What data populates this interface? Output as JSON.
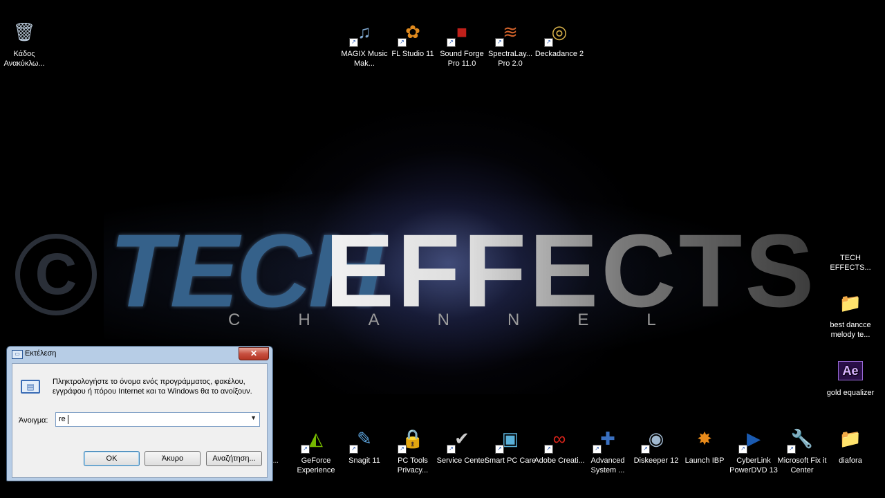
{
  "wallpaper": {
    "logo_tech": "TECH",
    "logo_effects": "EFFECTS",
    "logo_channel": "CHANNEL",
    "logo_symbol": "C"
  },
  "desktop_icons": [
    {
      "id": "recycle-bin",
      "label": "Κάδος Ανακύκλω...",
      "icon": "recycle-bin-icon",
      "color": "#b8c8d8",
      "glyph": "🗑",
      "shortcut": false
    },
    {
      "id": "magix",
      "label": "MAGIX Music Mak...",
      "icon": "magix-icon",
      "color": "#7fa8d0",
      "glyph": "♫",
      "shortcut": true
    },
    {
      "id": "fl-studio",
      "label": "FL Studio 11",
      "icon": "fl-studio-icon",
      "color": "#e08a1e",
      "glyph": "✿",
      "shortcut": true
    },
    {
      "id": "sound-forge",
      "label": "Sound Forge Pro 11.0",
      "icon": "sound-forge-icon",
      "color": "#c0201a",
      "glyph": "■",
      "shortcut": true
    },
    {
      "id": "spectralayers",
      "label": "SpectraLay... Pro 2.0",
      "icon": "spectralayers-icon",
      "color": "#d2622a",
      "glyph": "≋",
      "shortcut": true
    },
    {
      "id": "deckadance",
      "label": "Deckadance 2",
      "icon": "deckadance-icon",
      "color": "#d9b24a",
      "glyph": "◎",
      "shortcut": true
    },
    {
      "id": "tech-effects",
      "label": "TECH EFFECTS...",
      "icon": "tech-effects-icon",
      "color": "#000000",
      "glyph": "",
      "shortcut": false
    },
    {
      "id": "best-dance",
      "label": "best dancce melody te...",
      "icon": "folder-icon",
      "color": "#e8c66a",
      "glyph": "📁",
      "shortcut": false
    },
    {
      "id": "gold-equalizer",
      "label": "gold equalizer",
      "icon": "after-effects-file-icon",
      "color": "#3a1b5c",
      "glyph": "Ae",
      "shortcut": false
    },
    {
      "id": "partial",
      "label": "...ell...",
      "icon": "partial-app-icon",
      "color": "#4a7ab0",
      "glyph": "◐",
      "shortcut": true
    },
    {
      "id": "geforce",
      "label": "GeForce Experience",
      "icon": "geforce-icon",
      "color": "#76b900",
      "glyph": "◭",
      "shortcut": true
    },
    {
      "id": "snagit",
      "label": "Snagit 11",
      "icon": "snagit-icon",
      "color": "#5aa0d8",
      "glyph": "✎",
      "shortcut": true
    },
    {
      "id": "pc-tools",
      "label": "PC Tools Privacy...",
      "icon": "pc-tools-icon",
      "color": "#3a8ad8",
      "glyph": "🔒",
      "shortcut": true
    },
    {
      "id": "service-center",
      "label": "Service Center",
      "icon": "service-center-icon",
      "color": "#cccccc",
      "glyph": "✔",
      "shortcut": true
    },
    {
      "id": "smart-pc-care",
      "label": "Smart PC Care",
      "icon": "smart-pc-care-icon",
      "color": "#5ab0d8",
      "glyph": "▣",
      "shortcut": true
    },
    {
      "id": "adobe-creative",
      "label": "Adobe Creati...",
      "icon": "adobe-creative-cloud-icon",
      "color": "#d8231a",
      "glyph": "∞",
      "shortcut": true
    },
    {
      "id": "advanced-system",
      "label": "Advanced System ...",
      "icon": "advanced-system-care-icon",
      "color": "#3a70c0",
      "glyph": "✚",
      "shortcut": true
    },
    {
      "id": "diskeeper",
      "label": "Diskeeper 12",
      "icon": "diskeeper-icon",
      "color": "#a0b8d0",
      "glyph": "◉",
      "shortcut": true
    },
    {
      "id": "launch-ibp",
      "label": "Launch IBP",
      "icon": "launch-ibp-icon",
      "color": "#e88a1a",
      "glyph": "✸",
      "shortcut": false
    },
    {
      "id": "cyberlink",
      "label": "CyberLink PowerDVD 13",
      "icon": "powerdvd-icon",
      "color": "#1a5ab0",
      "glyph": "▶",
      "shortcut": true
    },
    {
      "id": "fixit",
      "label": "Microsoft Fix it Center",
      "icon": "fix-it-icon",
      "color": "#2a60b0",
      "glyph": "🔧",
      "shortcut": true
    },
    {
      "id": "diafora",
      "label": "diafora",
      "icon": "folder-icon",
      "color": "#e8c66a",
      "glyph": "📁",
      "shortcut": false
    }
  ],
  "run_dialog": {
    "title": "Εκτέλεση",
    "close_glyph": "✕",
    "description": "Πληκτρολογήστε το όνομα ενός προγράμματος, φακέλου, εγγράφου ή πόρου Internet και τα Windows θα το ανοίξουν.",
    "open_label": "Άνοιγμα:",
    "input_value": "re",
    "ok_label": "OK",
    "cancel_label": "Άκυρο",
    "browse_label": "Αναζήτηση..."
  }
}
